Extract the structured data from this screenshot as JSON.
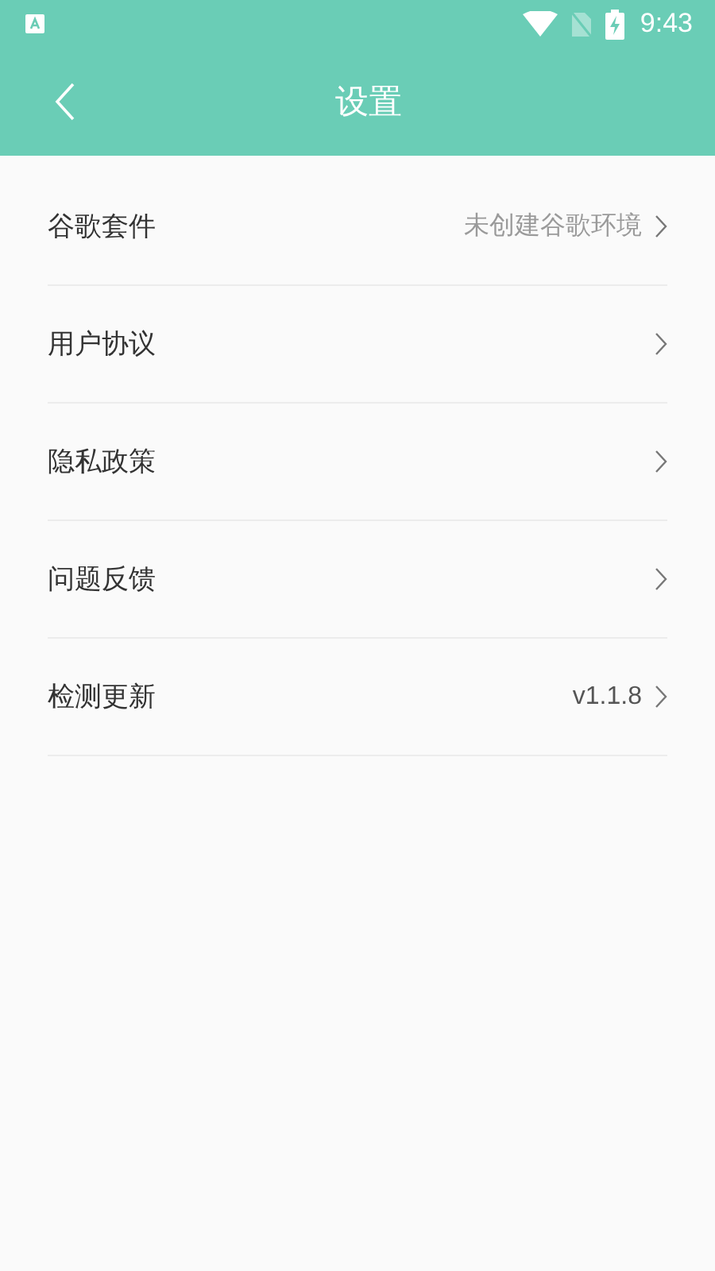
{
  "status_bar": {
    "time": "9:43"
  },
  "header": {
    "title": "设置"
  },
  "settings": [
    {
      "label": "谷歌套件",
      "value": "未创建谷歌环境",
      "dimmed": true
    },
    {
      "label": "用户协议"
    },
    {
      "label": "隐私政策"
    },
    {
      "label": "问题反馈"
    },
    {
      "label": "检测更新",
      "value": "v1.1.8",
      "dimmed": false
    }
  ]
}
